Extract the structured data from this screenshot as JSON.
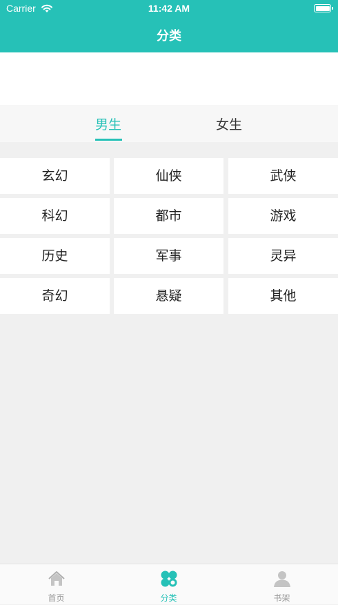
{
  "status_bar": {
    "carrier": "Carrier",
    "time": "11:42 AM"
  },
  "nav": {
    "title": "分类"
  },
  "gender_tabs": [
    {
      "label": "男生",
      "active": true
    },
    {
      "label": "女生",
      "active": false
    }
  ],
  "categories": [
    "玄幻",
    "仙侠",
    "武侠",
    "科幻",
    "都市",
    "游戏",
    "历史",
    "军事",
    "灵异",
    "奇幻",
    "悬疑",
    "其他"
  ],
  "tab_bar": [
    {
      "label": "首页",
      "icon": "home-icon",
      "active": false
    },
    {
      "label": "分类",
      "icon": "category-icon",
      "active": true
    },
    {
      "label": "书架",
      "icon": "person-icon",
      "active": false
    }
  ],
  "colors": {
    "accent": "#26c1b7",
    "background": "#f0f0f0",
    "inactive": "#999999"
  }
}
